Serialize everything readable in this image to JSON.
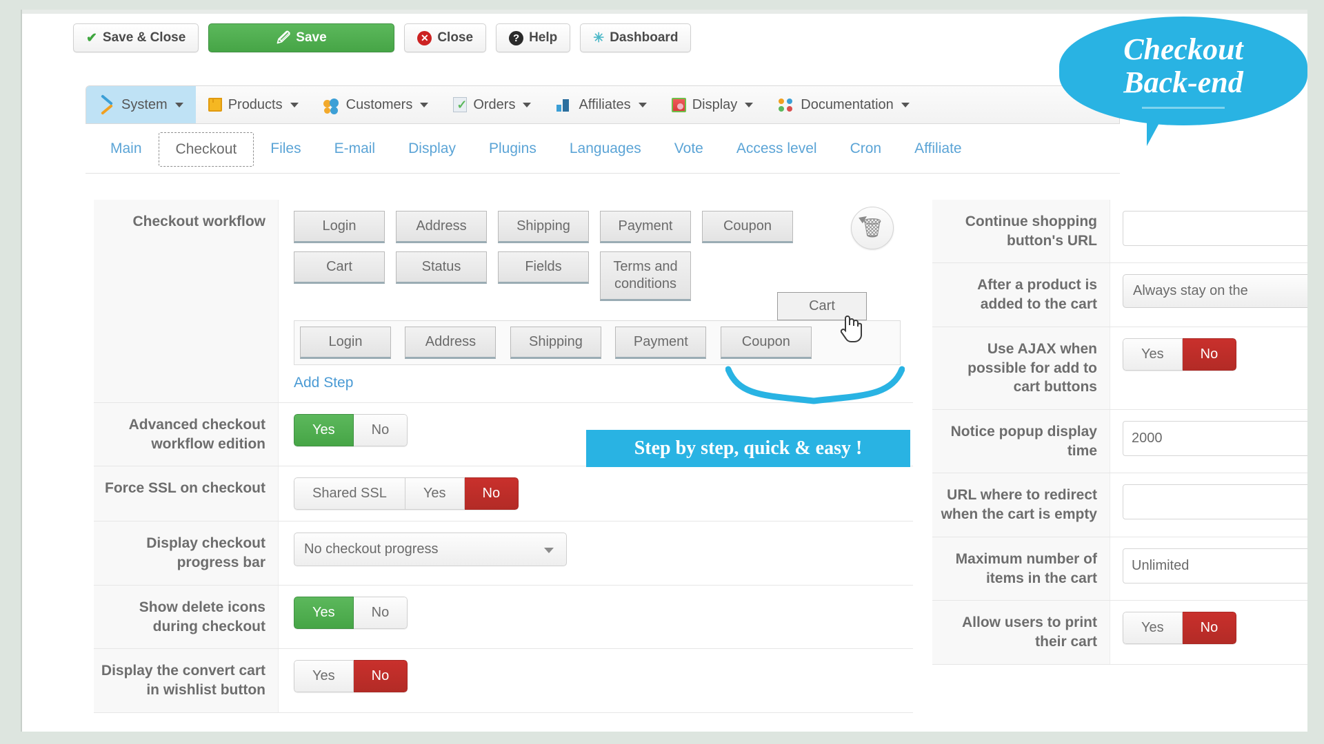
{
  "toolbar": {
    "buttons": [
      {
        "label": "Save & Close",
        "icon": "check-icon"
      },
      {
        "label": "Save",
        "icon": "save-icon"
      },
      {
        "label": "Close",
        "icon": "close-icon"
      },
      {
        "label": "Help",
        "icon": "help-icon"
      },
      {
        "label": "Dashboard",
        "icon": "dashboard-icon"
      }
    ]
  },
  "modnav": {
    "items": [
      {
        "label": "System",
        "icon": "wrench-screwdriver-icon",
        "active": true
      },
      {
        "label": "Products",
        "icon": "box-icon",
        "active": false
      },
      {
        "label": "Customers",
        "icon": "users-icon",
        "active": false
      },
      {
        "label": "Orders",
        "icon": "order-document-icon",
        "active": false
      },
      {
        "label": "Affiliates",
        "icon": "bar-people-icon",
        "active": false
      },
      {
        "label": "Display",
        "icon": "monitor-icon",
        "active": false
      },
      {
        "label": "Documentation",
        "icon": "four-dots-icon",
        "active": false
      }
    ]
  },
  "subtabs": {
    "items": [
      {
        "label": "Main",
        "active": false
      },
      {
        "label": "Checkout",
        "active": true
      },
      {
        "label": "Files",
        "active": false
      },
      {
        "label": "E-mail",
        "active": false
      },
      {
        "label": "Display",
        "active": false
      },
      {
        "label": "Plugins",
        "active": false
      },
      {
        "label": "Languages",
        "active": false
      },
      {
        "label": "Vote",
        "active": false
      },
      {
        "label": "Access level",
        "active": false
      },
      {
        "label": "Cron",
        "active": false
      },
      {
        "label": "Affiliate",
        "active": false
      }
    ]
  },
  "left_pane": {
    "workflow": {
      "label": "Checkout workflow",
      "available_row1": [
        "Login",
        "Address",
        "Shipping",
        "Payment",
        "Coupon"
      ],
      "available_row2": [
        "Cart",
        "Status",
        "Fields",
        "Terms and conditions"
      ],
      "dropzone_steps": [
        "Login",
        "Address",
        "Shipping",
        "Payment",
        "Coupon"
      ],
      "dragged_step": "Cart",
      "add_step_link": "Add Step",
      "trash_icon": "trash-icon"
    },
    "rows": [
      {
        "label": "Advanced checkout workflow edition",
        "type": "toggle",
        "options": [
          "Yes",
          "No"
        ],
        "selected": "Yes"
      },
      {
        "label": "Force SSL on checkout",
        "type": "toggle",
        "options": [
          "Shared SSL",
          "Yes",
          "No"
        ],
        "selected": "No"
      },
      {
        "label": "Display checkout progress bar",
        "type": "select",
        "value": "No checkout progress"
      },
      {
        "label": "Show delete icons during checkout",
        "type": "toggle",
        "options": [
          "Yes",
          "No"
        ],
        "selected": "Yes"
      },
      {
        "label": "Display the convert cart in wishlist button",
        "type": "toggle",
        "options": [
          "Yes",
          "No"
        ],
        "selected": "No"
      }
    ]
  },
  "right_pane": {
    "rows": [
      {
        "label": "Continue shopping button's URL",
        "type": "text",
        "value": "",
        "placeholder": ""
      },
      {
        "label": "After a product is added to the cart",
        "type": "select",
        "value": "Always stay on the"
      },
      {
        "label": "Use AJAX when possible for add to cart buttons",
        "type": "toggle",
        "options": [
          "Yes",
          "No"
        ],
        "selected": "No"
      },
      {
        "label": "Notice popup display time",
        "type": "text",
        "value": "2000",
        "placeholder": ""
      },
      {
        "label": "URL where to redirect when the cart is empty",
        "type": "text",
        "value": "",
        "placeholder": ""
      },
      {
        "label": "Maximum number of items in the cart",
        "type": "text",
        "value": "Unlimited",
        "placeholder": ""
      },
      {
        "label": "Allow users to print their cart",
        "type": "toggle",
        "options": [
          "Yes",
          "No"
        ],
        "selected": "No"
      }
    ]
  },
  "callouts": {
    "title_line1": "Checkout",
    "title_line2": "Back-end",
    "banner": "Step by step, quick & easy !"
  },
  "colors": {
    "accent_blue": "#29b3e3",
    "link_blue": "#5ba4d6",
    "green": "#5cb85c",
    "red": "#c9302c",
    "page_bg": "#dde5df"
  }
}
